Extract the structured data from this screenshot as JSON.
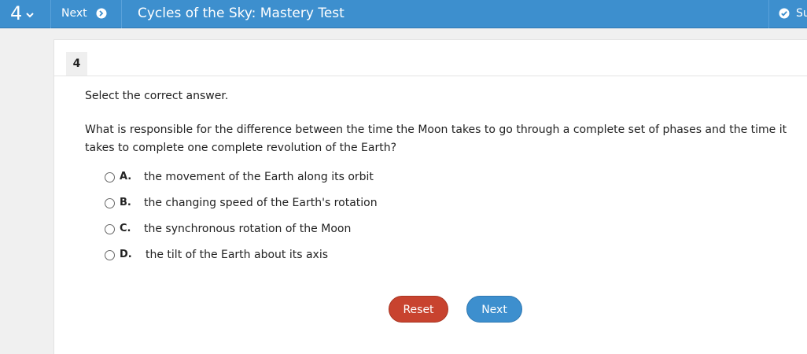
{
  "topbar": {
    "question_number": "4",
    "next_label": "Next",
    "title": "Cycles of the Sky: Mastery Test",
    "submit_label": "Su",
    "icons": [
      "chevron-down-icon",
      "arrow-right-circle-icon",
      "check-circle-icon"
    ]
  },
  "card": {
    "badge": "4",
    "instruction": "Select the correct answer.",
    "question": "What is responsible for the difference between the time the Moon takes to go through a complete set of phases and the time it takes to complete one complete revolution of the Earth?",
    "options": [
      {
        "letter": "A.",
        "text": "the movement of the Earth along its orbit"
      },
      {
        "letter": "B.",
        "text": "the changing speed of the Earth's rotation"
      },
      {
        "letter": "C.",
        "text": "the synchronous rotation of the Moon"
      },
      {
        "letter": "D.",
        "text": "the tilt of the Earth about its axis"
      }
    ],
    "reset_label": "Reset",
    "next_label": "Next"
  },
  "colors": {
    "topbar": "#3d8fce",
    "reset": "#c8432f",
    "next": "#3d8fce",
    "background": "#f0f0f0"
  }
}
